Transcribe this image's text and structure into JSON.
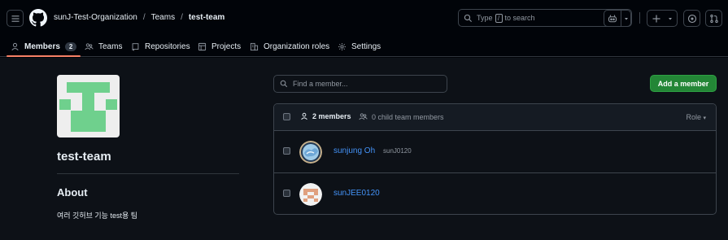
{
  "breadcrumb": {
    "org": "sunJ-Test-Organization",
    "section": "Teams",
    "team": "test-team",
    "sep": "/"
  },
  "search": {
    "prefix": "Type",
    "key": "/",
    "suffix": "to search"
  },
  "tabs": [
    {
      "label": "Members",
      "count": "2",
      "icon": "person-icon",
      "active": true
    },
    {
      "label": "Teams",
      "icon": "people-icon"
    },
    {
      "label": "Repositories",
      "icon": "repo-icon"
    },
    {
      "label": "Projects",
      "icon": "table-icon"
    },
    {
      "label": "Organization roles",
      "icon": "org-icon"
    },
    {
      "label": "Settings",
      "icon": "gear-icon"
    }
  ],
  "team": {
    "name": "test-team",
    "about_heading": "About",
    "about_text": "여러 깃허브 기능 test용 팀"
  },
  "members": {
    "search_placeholder": "Find a member...",
    "add_button": "Add a member",
    "header": {
      "members_count": "2 members",
      "child_members": "0 child team members",
      "role_label": "Role"
    },
    "rows": [
      {
        "name": "sunjung Oh",
        "login": "sunJ0120"
      },
      {
        "name": "sunJEE0120",
        "login": ""
      }
    ]
  },
  "colors": {
    "accent_tab": "#f78166",
    "link": "#4493f8",
    "primary_button": "#238636",
    "team_avatar": "#6fd08d"
  }
}
